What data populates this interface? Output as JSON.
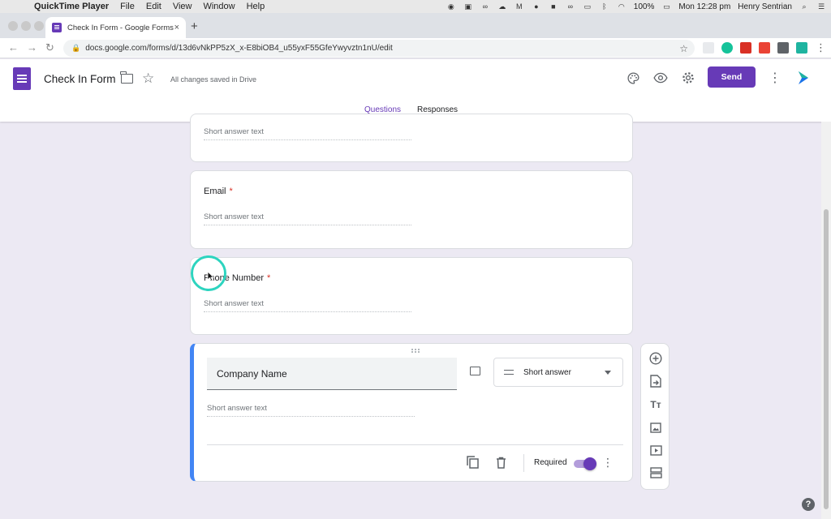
{
  "menubar": {
    "app_name": "QuickTime Player",
    "menus": [
      "File",
      "Edit",
      "View",
      "Window",
      "Help"
    ],
    "battery": "100%",
    "clock": "Mon 12:28 pm",
    "user": "Henry Sentrian"
  },
  "browser": {
    "tab_title": "Check In Form - Google Forms",
    "tab_close": "×",
    "new_tab": "+",
    "url": "docs.google.com/forms/d/13d6vNkPP5zX_x-E8biOB4_u55yxF55GfeYwyvztn1nU/edit"
  },
  "header": {
    "title": "Check In Form",
    "saved_status": "All changes saved in Drive",
    "send_label": "Send",
    "tabs": [
      "Questions",
      "Responses"
    ]
  },
  "questions": [
    {
      "label": "",
      "placeholder": "Short answer text"
    },
    {
      "label": "Email",
      "required_mark": "*",
      "placeholder": "Short answer text"
    },
    {
      "label": "Phone Number",
      "required_mark": "*",
      "placeholder": "Short answer text"
    }
  ],
  "active_question": {
    "title": "Company Name",
    "type": "Short answer",
    "placeholder": "Short answer text",
    "required_label": "Required",
    "required_on": true
  },
  "colors": {
    "accent": "#673ab7",
    "active_border": "#4285f4",
    "required": "#d93025",
    "cursor_highlight": "#2dd4bf"
  }
}
